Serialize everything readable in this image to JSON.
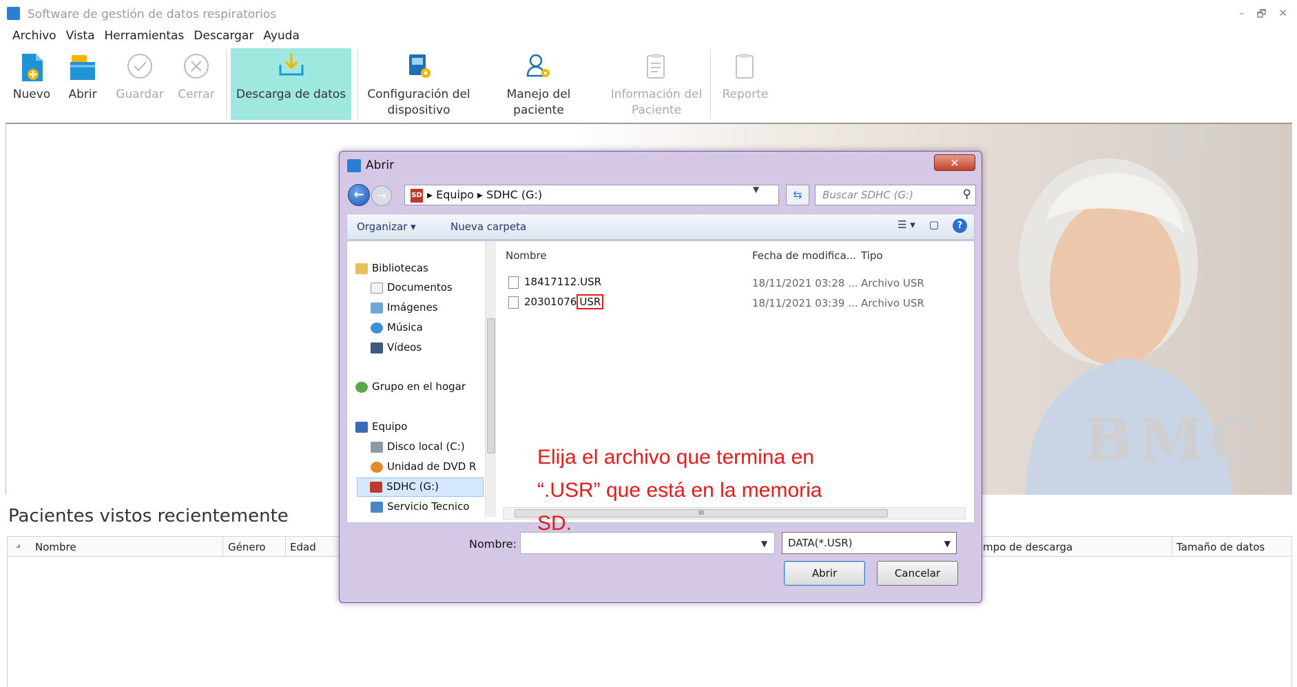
{
  "app": {
    "title": "Software de gestión de datos respiratorios",
    "window_controls": [
      "–",
      "🗗",
      "✕"
    ],
    "menu": [
      "Archivo",
      "Vista",
      "Herramientas",
      "Descargar",
      "Ayuda"
    ]
  },
  "toolbar": {
    "nuevo": "Nuevo",
    "abrir": "Abrir",
    "guardar": "Guardar",
    "cerrar": "Cerrar",
    "descarga": "Descarga de datos",
    "config_l1": "Configuración del",
    "config_l2": "dispositivo",
    "manejo": "Manejo del paciente",
    "info_l1": "Información del",
    "info_l2": "Paciente",
    "reporte": "Reporte"
  },
  "banner": {
    "logo": "BMC"
  },
  "recent": {
    "title": "Pacientes vistos recientemente",
    "columns": [
      "Nombre",
      "Género",
      "Edad",
      "mpo de descarga",
      "Tamaño de datos"
    ]
  },
  "dialog": {
    "title": "Abrir",
    "close": "✕",
    "address": {
      "sd_badge": "SD",
      "path": "▸ Equipo ▸ SDHC (G:)"
    },
    "search_placeholder": "Buscar SDHC (G:)",
    "commands": {
      "organize": "Organizar ▾",
      "new_folder": "Nueva carpeta",
      "view": "☰ ▾",
      "pane": "▢",
      "help": "?"
    },
    "tree": [
      "Bibliotecas",
      "Documentos",
      "Imágenes",
      "Música",
      "Vídeos",
      "Grupo en el hogar",
      "Equipo",
      "Disco local (C:)",
      "Unidad de DVD R",
      "SDHC (G:)",
      "Servicio Tecnico"
    ],
    "file_columns": {
      "name": "Nombre",
      "date": "Fecha de modifica...",
      "type": "Tipo"
    },
    "files": [
      {
        "name": "18417112.USR",
        "date": "18/11/2021 03:28 ...",
        "type": "Archivo USR"
      },
      {
        "name_stem": "20301076",
        "name_ext": "USR",
        "date": "18/11/2021 03:39 ...",
        "type": "Archivo USR"
      }
    ],
    "annotation": "Elija el archivo que termina en “.USR” que está en la memoria SD.",
    "filename_label": "Nombre:",
    "filename_value": "",
    "filter": "DATA(*.USR)",
    "open_button": "Abrir",
    "cancel_button": "Cancelar"
  },
  "colors": {
    "active_tool": "#9fe8e0",
    "dialog_frame": "#d4c8e6",
    "annotation": "#e21b1b"
  }
}
